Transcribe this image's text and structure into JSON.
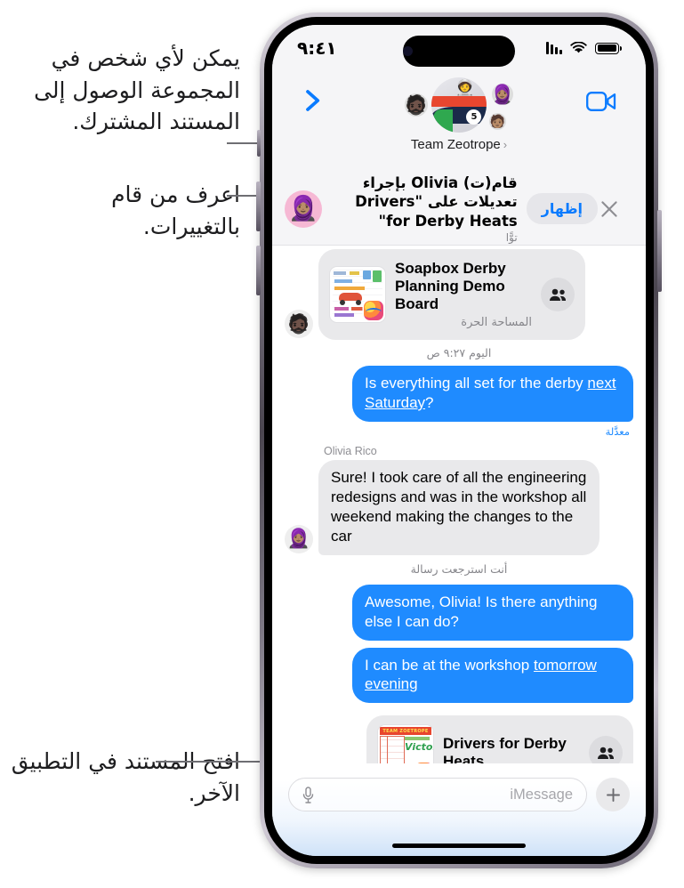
{
  "annotations": [
    {
      "id": "callout-sharing",
      "text": "يمكن لأي شخص في المجموعة الوصول إلى المستند المشترك."
    },
    {
      "id": "callout-changes",
      "text": "اعرف من قام بالتغييرات."
    },
    {
      "id": "callout-open-doc",
      "text": "افتح المستند في التطبيق الآخر."
    }
  ],
  "status_bar": {
    "time": "٩:٤١",
    "battery_icon": "battery-icon",
    "wifi_icon": "wifi-icon",
    "cellular_icon": "cellular-bars-icon"
  },
  "nav_bar": {
    "video_icon": "facetime-video-icon",
    "back_icon": "chevron-right-icon",
    "group_name": "Team Zeotrope",
    "group_chevron": "chevron-left-small-icon",
    "avatars": {
      "main": "🏎️",
      "member_1": "🧔🏿",
      "member_2": "🧕🏽",
      "member_3": "🧑🏽"
    }
  },
  "collab_banner": {
    "title": "قام(ت) Olivia بإجراء تعديلات على \"Drivers for Derby Heats\"",
    "time": "توًّا",
    "show_label": "إظهار",
    "close_icon": "close-icon",
    "avatar": "🧕🏽"
  },
  "conversation": {
    "doc_card_top": {
      "title": "Soapbox Derby Planning Demo Board",
      "subtitle": "المساحة الحرة",
      "people_icon": "people-icon",
      "thumbnail": "board-thumbnail",
      "sender_avatar": "🧔🏿"
    },
    "daystamp": "اليوم ٩:٢٧ ص",
    "message_1": {
      "text_plain": "Is everything all set for the derby ",
      "text_link": "next Saturday",
      "text_tail": "?",
      "edited_label": "معدَّلة"
    },
    "sender_name": "Olivia Rico",
    "message_2": {
      "text": "Sure! I took care of all the engineering redesigns and was in the workshop all weekend making the changes to the car",
      "avatar": "🧕🏽"
    },
    "system_note": "أنت استرجعت رسالة",
    "message_3": {
      "text": "Awesome, Olivia! Is there anything else I can do?"
    },
    "message_4": {
      "text_plain": "I can be at the workshop ",
      "text_link": "tomorrow evening"
    },
    "doc_card_bottom": {
      "title": "Drivers for Derby Heats",
      "people_icon": "people-icon",
      "thumbnail": "heats-thumbnail"
    }
  },
  "input_bar": {
    "plus_icon": "plus-icon",
    "placeholder": "iMessage",
    "mic_icon": "microphone-icon"
  },
  "colors": {
    "imessage_blue": "#1f8bff",
    "incoming_gray": "#e9e9eb",
    "accent_link": "#0a7bff",
    "chrome_gray": "#f5f5f7"
  }
}
